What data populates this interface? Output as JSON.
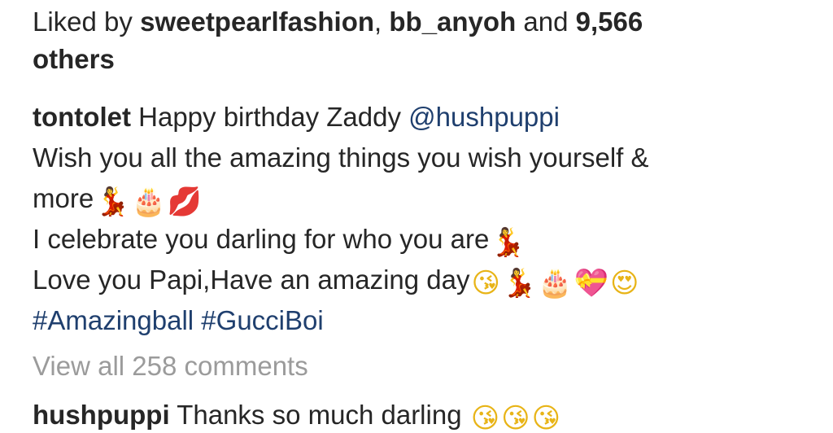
{
  "likes": {
    "prefix": "Liked by ",
    "user1": "sweetpearlfashion",
    "sep": ", ",
    "user2": "bb_anyoh",
    "and": " and ",
    "count": "9,566",
    "others": "others"
  },
  "caption": {
    "username": "tontolet",
    "line1_text": " Happy birthday Zaddy ",
    "mention": "@hushpuppi",
    "line2": "Wish you all the amazing things you wish yourself &",
    "line3": "more",
    "line4": "I celebrate you darling for who you are",
    "line5": "Love you Papi,Have an amazing day",
    "hashtag1": "#Amazingball",
    "hashtag2": "#GucciBoi"
  },
  "view_all": "View all 258 comments",
  "comment": {
    "username": "hushpuppi",
    "text": " Thanks so much darling "
  },
  "icons": {
    "dancer": "dancer-icon",
    "cake": "birthday-cake-icon",
    "lips": "kiss-mark-icon",
    "kiss": "face-blowing-kiss-icon",
    "heart": "heart-with-ribbon-icon",
    "love": "heart-eyes-icon"
  },
  "colors": {
    "text": "#262626",
    "link": "#1f3f6e",
    "muted": "#9b9b9b"
  }
}
